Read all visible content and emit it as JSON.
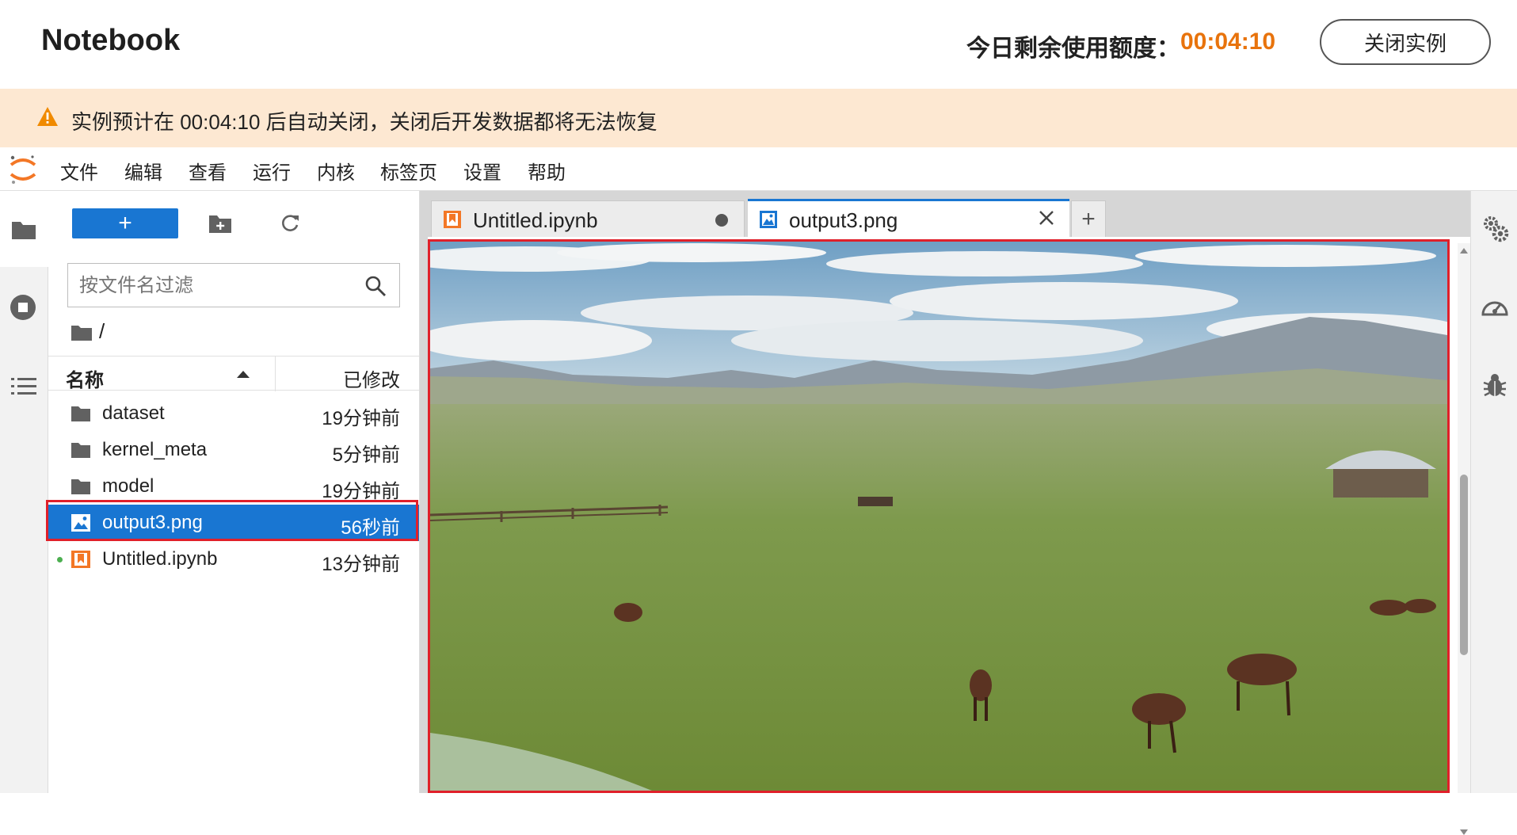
{
  "header": {
    "title": "Notebook",
    "quota_label": "今日剩余使用额度：",
    "quota_time": "00:04:10",
    "close_instance_label": "关闭实例"
  },
  "banner": {
    "message": "实例预计在 00:04:10 后自动关闭，关闭后开发数据都将无法恢复"
  },
  "menu": {
    "items": [
      "文件",
      "编辑",
      "查看",
      "运行",
      "内核",
      "标签页",
      "设置",
      "帮助"
    ]
  },
  "file_browser": {
    "new_label": "+",
    "filter_placeholder": "按文件名过滤",
    "breadcrumb": "/",
    "columns": {
      "name": "名称",
      "modified": "已修改"
    },
    "files": [
      {
        "name": "dataset",
        "modified": "19分钟前",
        "type": "folder"
      },
      {
        "name": "kernel_meta",
        "modified": "5分钟前",
        "type": "folder"
      },
      {
        "name": "model",
        "modified": "19分钟前",
        "type": "folder"
      },
      {
        "name": "output3.png",
        "modified": "56秒前",
        "type": "image",
        "selected": true
      },
      {
        "name": "Untitled.ipynb",
        "modified": "13分钟前",
        "type": "notebook",
        "running": true
      }
    ]
  },
  "tabs": [
    {
      "label": "Untitled.ipynb",
      "icon": "notebook-icon",
      "unsaved": true
    },
    {
      "label": "output3.png",
      "icon": "image-icon",
      "active": true
    }
  ],
  "new_tab_label": "+",
  "viewer": {
    "image_subject": "grassland-with-horses-and-yurt"
  },
  "colors": {
    "accent": "#1976d2",
    "quota": "#e8730c",
    "banner_bg": "#fde8d2",
    "highlight": "#e0202a"
  }
}
